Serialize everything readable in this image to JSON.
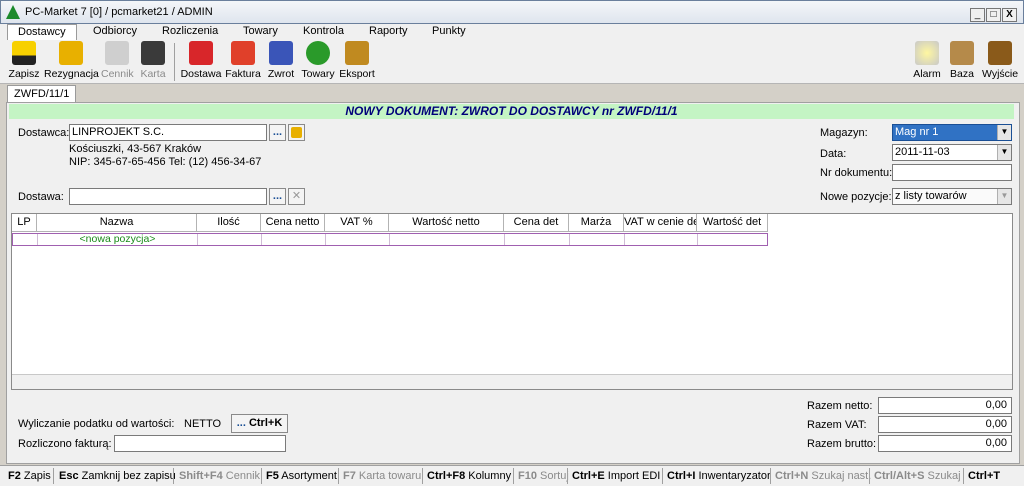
{
  "window": {
    "title": "PC-Market 7 [0] / pcmarket21 / ADMIN",
    "controls": [
      "_",
      "□",
      "X"
    ]
  },
  "menu": [
    {
      "label": "Dostawcy",
      "active": true
    },
    {
      "label": "Odbiorcy"
    },
    {
      "label": "Rozliczenia"
    },
    {
      "label": "Towary"
    },
    {
      "label": "Kontrola"
    },
    {
      "label": "Raporty"
    },
    {
      "label": "Punkty"
    }
  ],
  "toolbar": {
    "zapisz": "Zapisz",
    "rezygnacja": "Rezygnacja",
    "cennik": "Cennik",
    "karta": "Karta",
    "dostawa": "Dostawa",
    "faktura": "Faktura",
    "zwrot": "Zwrot",
    "towary": "Towary",
    "eksport": "Eksport",
    "alarm": "Alarm",
    "baza": "Baza",
    "wyjscie": "Wyjście"
  },
  "tab": {
    "label": "ZWFD/11/1"
  },
  "document": {
    "title": "NOWY DOKUMENT: ZWROT DO DOSTAWCY nr ZWFD/11/1",
    "dostawca_label": "Dostawca:",
    "dostawca_value": "LINPROJEKT S.C.",
    "address_line1": "Kościuszki, 43-567 Kraków",
    "address_line2": "NIP: 345-67-65-456 Tel: (12) 456-34-67",
    "dostawa_label": "Dostawa:",
    "dostawa_value": "",
    "magazyn_label": "Magazyn:",
    "magazyn_value": "Mag nr 1",
    "data_label": "Data:",
    "data_value": "2011-11-03",
    "nr_dok_label": "Nr dokumentu:",
    "nr_dok_value": "",
    "nowe_poz_label": "Nowe pozycje:",
    "nowe_poz_value": "z listy towarów",
    "ellipsis": "..."
  },
  "grid": {
    "columns": [
      "LP",
      "Nazwa",
      "Ilość",
      "Cena netto",
      "VAT %",
      "Wartość netto",
      "Cena det",
      "Marża",
      "VAT w cenie det",
      "Wartość det"
    ],
    "new_row": "<nowa pozycja>"
  },
  "footer": {
    "podatek_label": "Wyliczanie podatku od wartości:",
    "podatek_value": "NETTO",
    "ctrlk_label": "Ctrl+K",
    "ctrlk_dots": "...",
    "rozliczono_label": "Rozliczono fakturą:",
    "rozliczono_value": "",
    "razem_netto_label": "Razem netto:",
    "razem_netto": "0,00",
    "razem_vat_label": "Razem VAT:",
    "razem_vat": "0,00",
    "razem_brutto_label": "Razem brutto:",
    "razem_brutto": "0,00"
  },
  "statusbar": [
    {
      "key": "F2",
      "label": "Zapis",
      "enabled": true
    },
    {
      "key": "Esc",
      "label": "Zamknij bez zapisu",
      "enabled": true
    },
    {
      "key": "Shift+F4",
      "label": "Cennik",
      "enabled": false
    },
    {
      "key": "F5",
      "label": "Asortyment",
      "enabled": true
    },
    {
      "key": "F7",
      "label": "Karta towaru",
      "enabled": false
    },
    {
      "key": "Ctrl+F8",
      "label": "Kolumny",
      "enabled": true
    },
    {
      "key": "F10",
      "label": "Sortuj",
      "enabled": false
    },
    {
      "key": "Ctrl+E",
      "label": "Import EDI",
      "enabled": true
    },
    {
      "key": "Ctrl+I",
      "label": "Inwentaryzator",
      "enabled": true
    },
    {
      "key": "Ctrl+N",
      "label": "Szukaj nast.",
      "enabled": false
    },
    {
      "key": "Ctrl/Alt+S",
      "label": "Szukaj",
      "enabled": false
    },
    {
      "key": "Ctrl+T",
      "label": "",
      "enabled": true
    }
  ],
  "colors": {
    "accent": "#3072c4",
    "doc_title_bg": "#c4f4c4",
    "doc_title_text": "#00007a"
  }
}
